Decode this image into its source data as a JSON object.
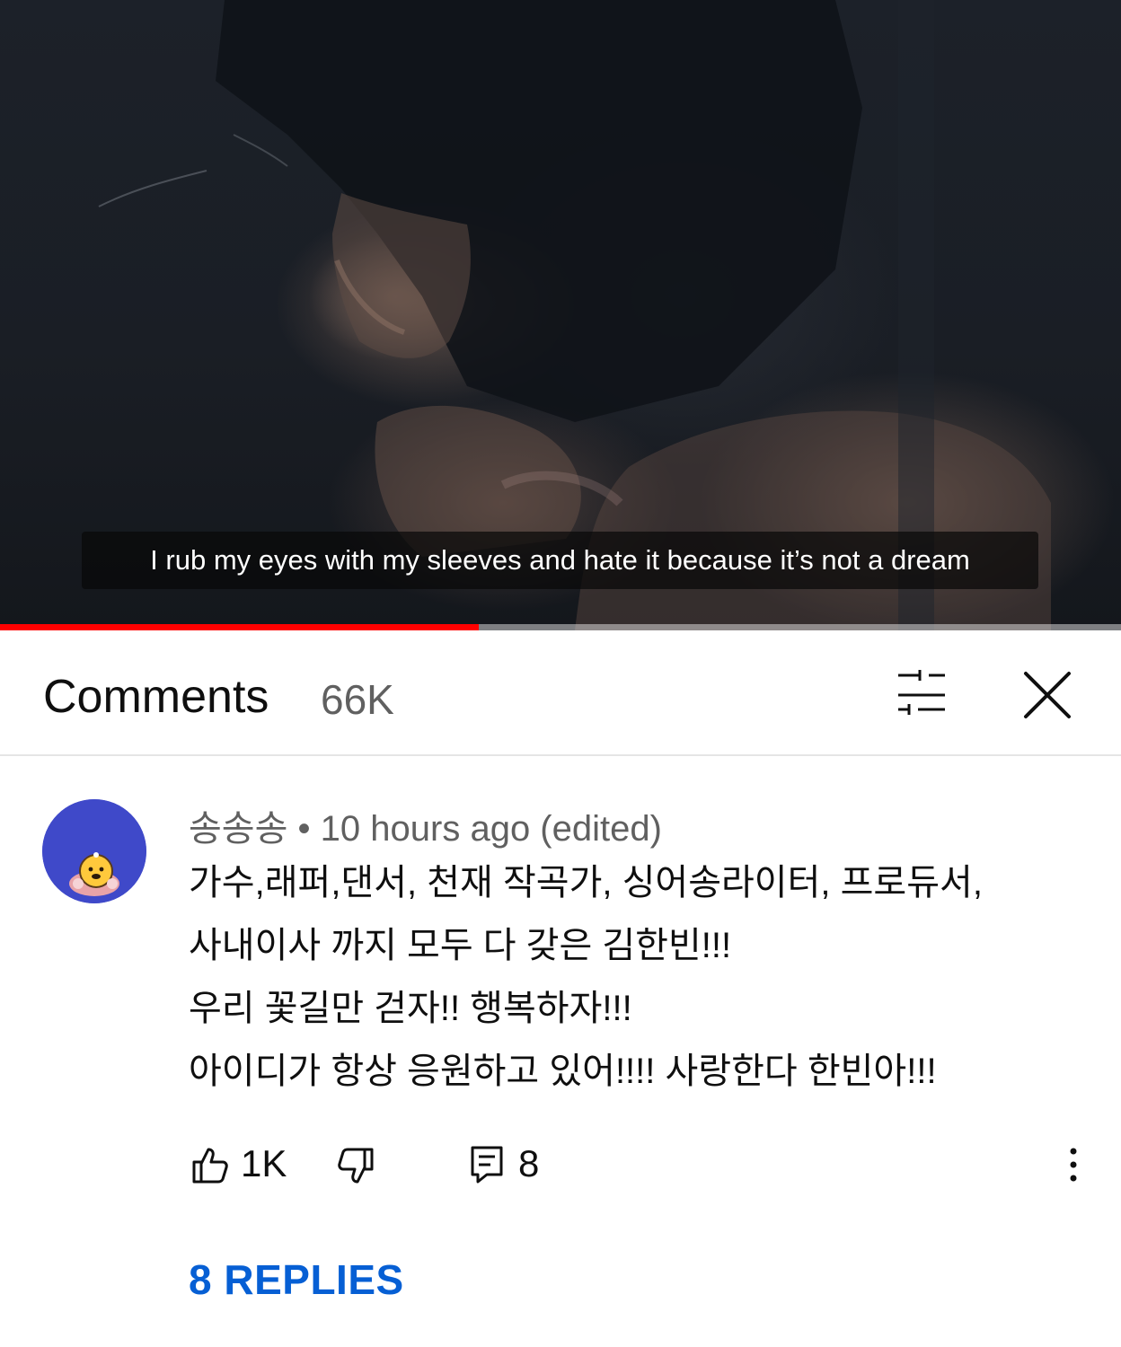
{
  "video": {
    "subtitle": "I rub my eyes with my sleeves and hate it because it’s not a dream",
    "progress_fraction": 0.427,
    "progress_color": "#ff0000"
  },
  "comments": {
    "title": "Comments",
    "count": "66K",
    "filter_icon": "sort-filter-icon",
    "close_icon": "close-icon"
  },
  "comment": {
    "author": "송송송",
    "separator": "•",
    "time": "10 hours ago (edited)",
    "lines": [
      "가수,래퍼,댄서, 천재 작곡가, 싱어송라이터, 프로듀서,",
      "사내이사 까지 모두 다 갖은 김한빈!!!",
      "우리 꽃길만 걷자!! 행복하자!!!",
      "아이디가 항상 응원하고 있어!!!! 사랑한다 한빈아!!!"
    ],
    "likes": "1K",
    "reply_count": "8",
    "replies_label": "8 REPLIES",
    "avatar_color": "#3f49c9",
    "link_color": "#065fd4"
  }
}
